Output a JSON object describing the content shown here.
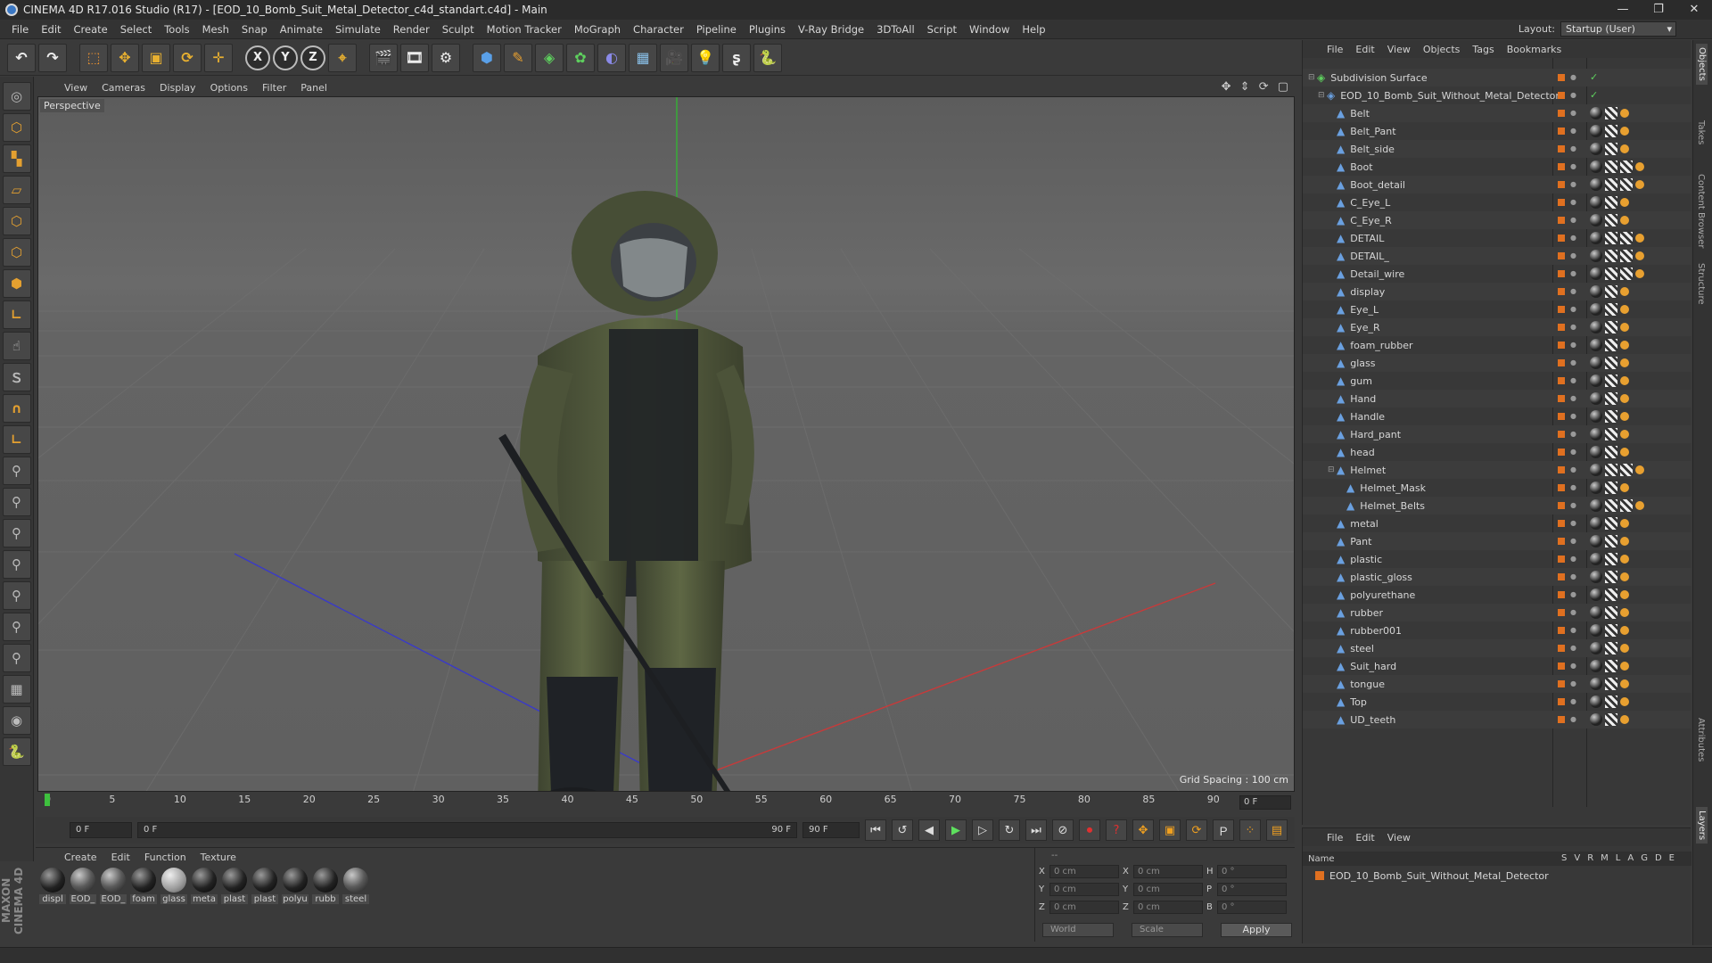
{
  "window": {
    "title": "CINEMA 4D R17.016 Studio (R17) - [EOD_10_Bomb_Suit_Metal_Detector_c4d_standart.c4d] - Main",
    "controls": [
      "—",
      "❐",
      "✕"
    ]
  },
  "menubar": {
    "items": [
      "File",
      "Edit",
      "Create",
      "Select",
      "Tools",
      "Mesh",
      "Snap",
      "Animate",
      "Simulate",
      "Render",
      "Sculpt",
      "Motion Tracker",
      "MoGraph",
      "Character",
      "Pipeline",
      "Plugins",
      "V-Ray Bridge",
      "3DToAll",
      "Script",
      "Window",
      "Help"
    ],
    "layout_label": "Layout:",
    "layout_value": "Startup (User)"
  },
  "toolbar": {
    "axis_x": "X",
    "axis_y": "Y",
    "axis_z": "Z"
  },
  "viewport": {
    "menu": [
      "View",
      "Cameras",
      "Display",
      "Options",
      "Filter",
      "Panel"
    ],
    "nav_icons": "✥ ⇕ ⟳ ▢",
    "label": "Perspective",
    "grid_spacing": "Grid Spacing : 100 cm"
  },
  "timeline": {
    "ticks": [
      "0",
      "5",
      "10",
      "15",
      "20",
      "25",
      "30",
      "35",
      "40",
      "45",
      "50",
      "55",
      "60",
      "65",
      "70",
      "75",
      "80",
      "85",
      "90"
    ],
    "current_frame": "0 F"
  },
  "transport": {
    "start_field": "0 F",
    "range_start": "0 F",
    "range_end": "90 F",
    "end_field": "90 F"
  },
  "materials": {
    "menu": [
      "Create",
      "Edit",
      "Function",
      "Texture"
    ],
    "items": [
      {
        "name": "displ",
        "style": "dark"
      },
      {
        "name": "EOD_",
        "style": "tex"
      },
      {
        "name": "EOD_",
        "style": "tex"
      },
      {
        "name": "foam",
        "style": "dark"
      },
      {
        "name": "glass",
        "style": "light"
      },
      {
        "name": "meta",
        "style": "dark"
      },
      {
        "name": "plast",
        "style": "dark"
      },
      {
        "name": "plast",
        "style": "dark"
      },
      {
        "name": "polyu",
        "style": "dark"
      },
      {
        "name": "rubb",
        "style": "dark"
      },
      {
        "name": "steel",
        "style": "tex"
      }
    ]
  },
  "coords": {
    "header": "--",
    "rows": [
      {
        "a1": "X",
        "v1": "0 cm",
        "a2": "X",
        "v2": "0 cm",
        "a3": "H",
        "v3": "0 °"
      },
      {
        "a1": "Y",
        "v1": "0 cm",
        "a2": "Y",
        "v2": "0 cm",
        "a3": "P",
        "v3": "0 °"
      },
      {
        "a1": "Z",
        "v1": "0 cm",
        "a2": "Z",
        "v2": "0 cm",
        "a3": "B",
        "v3": "0 °"
      }
    ],
    "mode_select": "World",
    "scale_select": "Scale",
    "apply": "Apply"
  },
  "object_manager": {
    "menu": [
      "File",
      "Edit",
      "View",
      "Objects",
      "Tags",
      "Bookmarks"
    ],
    "objects": [
      {
        "name": "Subdivision Surface",
        "depth": 0,
        "tree": "⊟",
        "tags": "none"
      },
      {
        "name": "EOD_10_Bomb_Suit_Without_Metal_Detector",
        "depth": 1,
        "tree": "⊟",
        "tags": "none"
      },
      {
        "name": "Belt",
        "depth": 2,
        "tree": "",
        "tags": "std"
      },
      {
        "name": "Belt_Pant",
        "depth": 2,
        "tree": "",
        "tags": "std"
      },
      {
        "name": "Belt_side",
        "depth": 2,
        "tree": "",
        "tags": "std"
      },
      {
        "name": "Boot",
        "depth": 2,
        "tree": "",
        "tags": "extra"
      },
      {
        "name": "Boot_detail",
        "depth": 2,
        "tree": "",
        "tags": "extra"
      },
      {
        "name": "C_Eye_L",
        "depth": 2,
        "tree": "",
        "tags": "std"
      },
      {
        "name": "C_Eye_R",
        "depth": 2,
        "tree": "",
        "tags": "std"
      },
      {
        "name": "DETAIL",
        "depth": 2,
        "tree": "",
        "tags": "extra"
      },
      {
        "name": "DETAIL_",
        "depth": 2,
        "tree": "",
        "tags": "extra"
      },
      {
        "name": "Detail_wire",
        "depth": 2,
        "tree": "",
        "tags": "extra"
      },
      {
        "name": "display",
        "depth": 2,
        "tree": "",
        "tags": "std"
      },
      {
        "name": "Eye_L",
        "depth": 2,
        "tree": "",
        "tags": "std"
      },
      {
        "name": "Eye_R",
        "depth": 2,
        "tree": "",
        "tags": "std"
      },
      {
        "name": "foam_rubber",
        "depth": 2,
        "tree": "",
        "tags": "std"
      },
      {
        "name": "glass",
        "depth": 2,
        "tree": "",
        "tags": "std"
      },
      {
        "name": "gum",
        "depth": 2,
        "tree": "",
        "tags": "std"
      },
      {
        "name": "Hand",
        "depth": 2,
        "tree": "",
        "tags": "std"
      },
      {
        "name": "Handle",
        "depth": 2,
        "tree": "",
        "tags": "std"
      },
      {
        "name": "Hard_pant",
        "depth": 2,
        "tree": "",
        "tags": "std"
      },
      {
        "name": "head",
        "depth": 2,
        "tree": "",
        "tags": "std"
      },
      {
        "name": "Helmet",
        "depth": 2,
        "tree": "⊟",
        "tags": "extra"
      },
      {
        "name": "Helmet_Mask",
        "depth": 3,
        "tree": "",
        "tags": "std"
      },
      {
        "name": "Helmet_Belts",
        "depth": 3,
        "tree": "",
        "tags": "extra"
      },
      {
        "name": "metal",
        "depth": 2,
        "tree": "",
        "tags": "std"
      },
      {
        "name": "Pant",
        "depth": 2,
        "tree": "",
        "tags": "std"
      },
      {
        "name": "plastic",
        "depth": 2,
        "tree": "",
        "tags": "std"
      },
      {
        "name": "plastic_gloss",
        "depth": 2,
        "tree": "",
        "tags": "std"
      },
      {
        "name": "polyurethane",
        "depth": 2,
        "tree": "",
        "tags": "std"
      },
      {
        "name": "rubber",
        "depth": 2,
        "tree": "",
        "tags": "std"
      },
      {
        "name": "rubber001",
        "depth": 2,
        "tree": "",
        "tags": "std"
      },
      {
        "name": "steel",
        "depth": 2,
        "tree": "",
        "tags": "std"
      },
      {
        "name": "Suit_hard",
        "depth": 2,
        "tree": "",
        "tags": "std"
      },
      {
        "name": "tongue",
        "depth": 2,
        "tree": "",
        "tags": "std"
      },
      {
        "name": "Top",
        "depth": 2,
        "tree": "",
        "tags": "std"
      },
      {
        "name": "UD_teeth",
        "depth": 2,
        "tree": "",
        "tags": "std"
      }
    ]
  },
  "layer_manager": {
    "menu": [
      "File",
      "Edit",
      "View"
    ],
    "header_name": "Name",
    "header_cols": [
      "S",
      "V",
      "R",
      "M",
      "L",
      "A",
      "G",
      "D",
      "E"
    ],
    "layers": [
      {
        "name": "EOD_10_Bomb_Suit_Without_Metal_Detector",
        "color": "#e07020"
      }
    ]
  },
  "right_tabs": [
    "Objects",
    "Takes",
    "Content Browser",
    "Structure",
    "Attributes",
    "Layers"
  ],
  "brand": "MAXON CINEMA 4D"
}
